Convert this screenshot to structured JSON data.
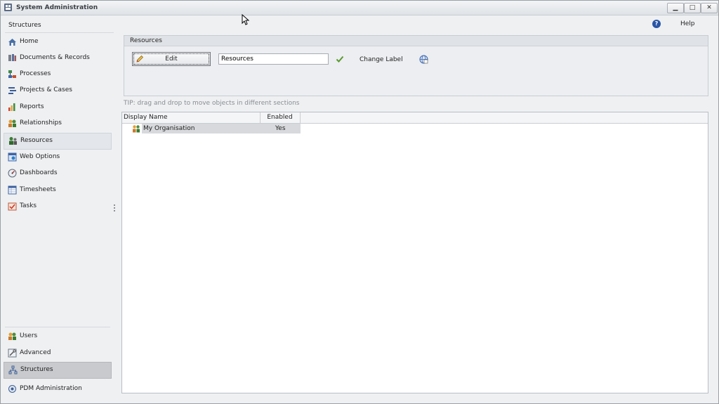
{
  "window": {
    "title": "System Administration",
    "controls": {
      "minimize": "▁",
      "maximize": "□",
      "close": "✕"
    }
  },
  "sidebar": {
    "title": "Structures",
    "items": [
      {
        "label": "Home",
        "icon": "home-icon"
      },
      {
        "label": "Documents & Records",
        "icon": "documents-icon"
      },
      {
        "label": "Processes",
        "icon": "processes-icon"
      },
      {
        "label": "Projects & Cases",
        "icon": "projects-icon"
      },
      {
        "label": "Reports",
        "icon": "reports-icon"
      },
      {
        "label": "Relationships",
        "icon": "relationships-icon"
      },
      {
        "label": "Resources",
        "icon": "resources-icon"
      },
      {
        "label": "Web Options",
        "icon": "web-options-icon"
      },
      {
        "label": "Dashboards",
        "icon": "dashboards-icon"
      },
      {
        "label": "Timesheets",
        "icon": "timesheets-icon"
      },
      {
        "label": "Tasks",
        "icon": "tasks-icon"
      }
    ],
    "bottom_items": [
      {
        "label": "Users",
        "icon": "users-icon"
      },
      {
        "label": "Advanced",
        "icon": "advanced-icon"
      },
      {
        "label": "Structures",
        "icon": "structures-icon"
      },
      {
        "label": "PDM Administration",
        "icon": "pdm-icon"
      }
    ]
  },
  "toolbar": {
    "help_label": "Help"
  },
  "resources_panel": {
    "title": "Resources",
    "edit_label": "Edit",
    "name_value": "Resources",
    "change_label": "Change Label"
  },
  "tip": "TIP: drag and drop to move objects in different sections",
  "grid": {
    "columns": [
      "Display Name",
      "Enabled"
    ],
    "rows": [
      {
        "name": "My Organisation",
        "enabled": "Yes"
      }
    ]
  },
  "colors": {
    "accent": "#2a55a5",
    "selected_bg": "#c8cacd",
    "check_green": "#5a9a2e"
  }
}
